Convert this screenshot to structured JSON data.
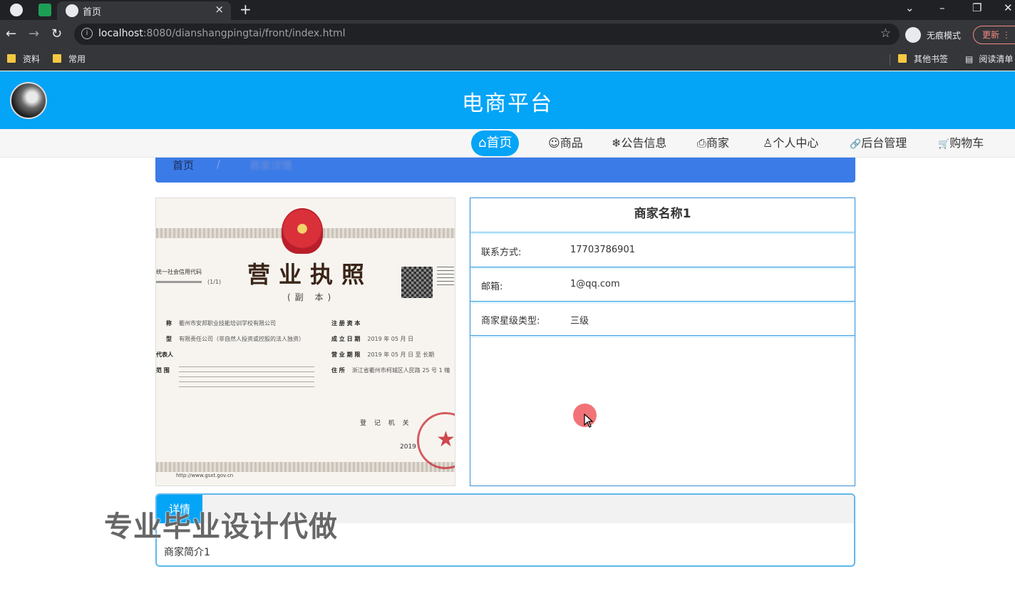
{
  "browser": {
    "tab_title": "首页",
    "tab_close": "×",
    "new_tab": "+",
    "url_host": "localhost",
    "url_rest": ":8080/dianshangpingtai/front/index.html",
    "incognito_label": "无痕模式",
    "update_label": "更新",
    "bookmarks": [
      "资料",
      "常用"
    ],
    "other_bookmarks": "其他书签",
    "reading_list": "阅读清单",
    "icons": [
      "back-arrow-icon",
      "forward-arrow-icon",
      "reload-icon",
      "info-icon",
      "star-icon"
    ]
  },
  "header": {
    "title": "电商平台"
  },
  "nav": {
    "items": [
      {
        "icon": "⌂",
        "label": "首页"
      },
      {
        "icon": "☺",
        "label": "商品"
      },
      {
        "icon": "❄",
        "label": "公告信息"
      },
      {
        "icon": "⎙",
        "label": "商家"
      },
      {
        "icon": "♙",
        "label": "个人中心"
      },
      {
        "icon": "🔗",
        "label": "后台管理"
      },
      {
        "icon": "🛒",
        "label": "购物车"
      }
    ]
  },
  "breadcrumb": {
    "home": "首页",
    "separator": "/",
    "current": "商家详情"
  },
  "license": {
    "title": "营业执照",
    "subtitle": "(副 本)",
    "code_label": "统一社会信用代码",
    "page_num": "(1/1)",
    "fields": {
      "name_label": "称",
      "name_value": "衢州市安邦职业技能培训学校有限公司",
      "type_label": "型",
      "type_value": "有限责任公司（非自然人投资或控股的法人独资）",
      "rep_label": "代表人",
      "scope_label": "范 围",
      "capital_label": "注 册 资 本",
      "date_label": "成 立 日 期",
      "date_value": "2019 年 05 月 日",
      "term_label": "营 业 期 限",
      "term_value": "2019 年 05 月 日 至 长期",
      "address_label": "住 所",
      "address_value": "浙江省衢州市柯城区人民路 25 号 1 幢"
    },
    "authority": "登 记 机 关",
    "year": "2019",
    "url": "http://www.gsxt.gov.cn"
  },
  "merchant": {
    "name": "商家名称1",
    "rows": [
      {
        "label": "联系方式:",
        "value": "17703786901"
      },
      {
        "label": "邮箱:",
        "value": "1@qq.com"
      },
      {
        "label": "商家星级类型:",
        "value": "三级"
      }
    ]
  },
  "details": {
    "tab": "详情",
    "text": "商家简介1"
  },
  "watermark": "专业毕业设计代做",
  "colors": {
    "primary": "#04a4f7",
    "breadcrumb": "#3b7be8"
  }
}
